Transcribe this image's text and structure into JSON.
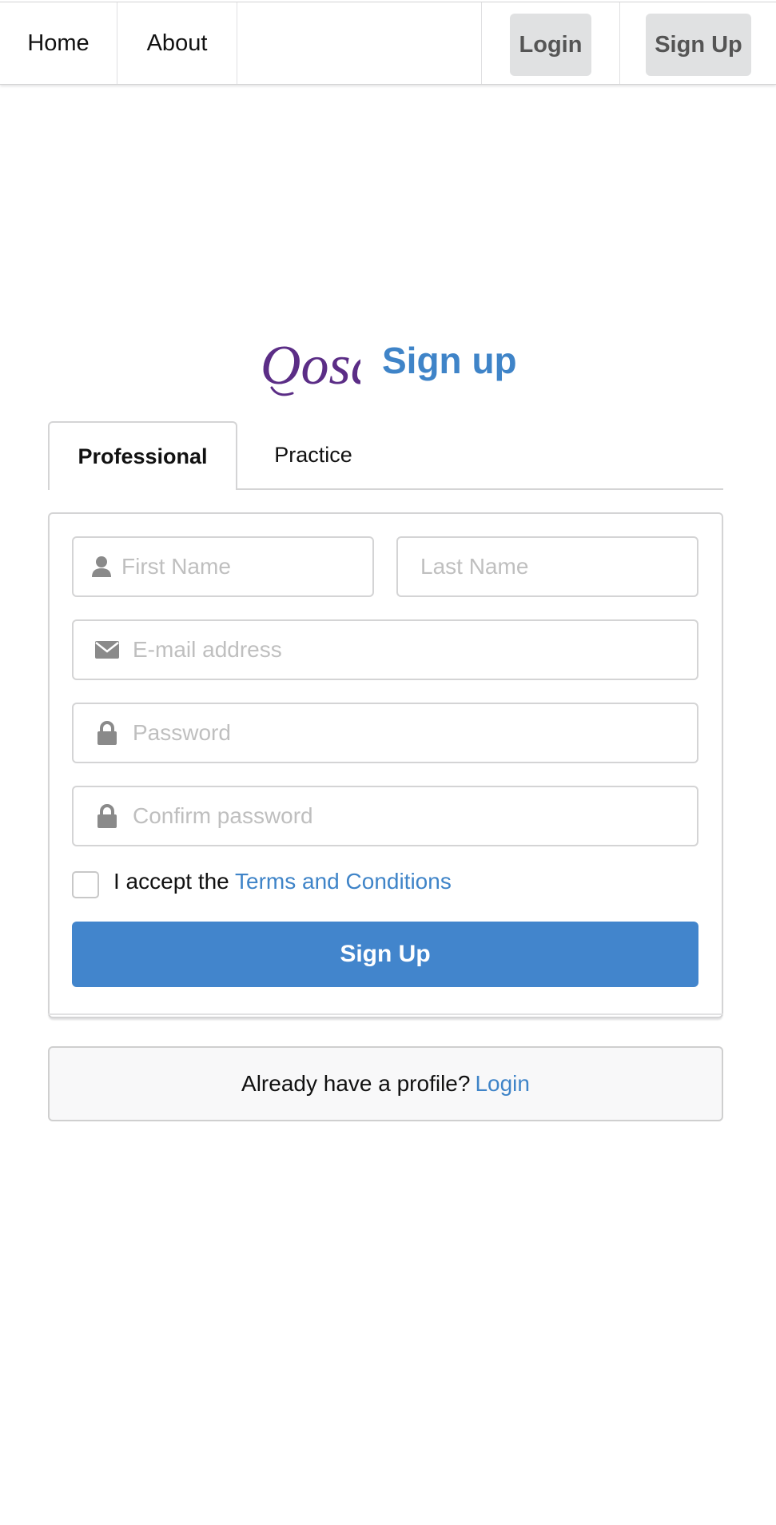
{
  "nav": {
    "home": "Home",
    "about": "About",
    "login": "Login",
    "signup": "Sign Up"
  },
  "brand": {
    "logo_text": "Oosa",
    "logo_color": "#5b2d86"
  },
  "page": {
    "heading": "Sign up",
    "accent_color": "#3f84c8"
  },
  "tabs": [
    {
      "label": "Professional",
      "active": true
    },
    {
      "label": "Practice",
      "active": false
    }
  ],
  "form": {
    "first_name": {
      "placeholder": "First Name",
      "value": "",
      "icon": "user-icon"
    },
    "last_name": {
      "placeholder": "Last Name",
      "value": ""
    },
    "email": {
      "placeholder": "E-mail address",
      "value": "",
      "icon": "envelope-icon"
    },
    "password": {
      "placeholder": "Password",
      "value": "",
      "icon": "lock-icon"
    },
    "confirm_password": {
      "placeholder": "Confirm password",
      "value": "",
      "icon": "lock-icon"
    },
    "terms": {
      "checked": false,
      "prefix": "I accept the ",
      "link": "Terms and Conditions"
    },
    "submit_label": "Sign Up",
    "submit_color": "#4285cc"
  },
  "footer": {
    "text": "Already have a profile?",
    "link": "Login"
  }
}
